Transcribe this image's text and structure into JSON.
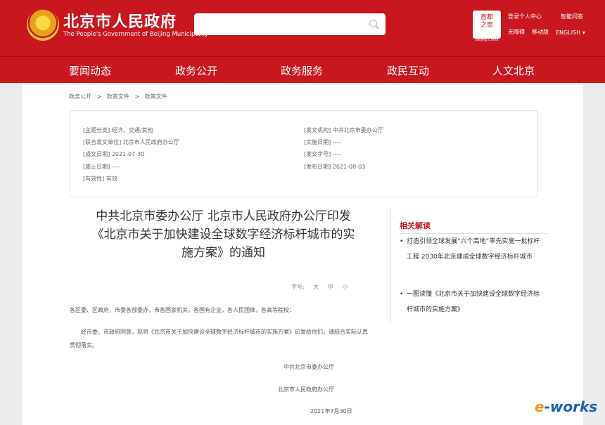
{
  "header": {
    "title": "北京市人民政府",
    "subtitle": "The People's Government of Beijing Municipality",
    "search_placeholder": "",
    "seal_top": "首都",
    "seal_bottom": "之窗",
    "seal_sub": "Beijing China",
    "links": [
      "登录个人中心",
      "智能问答",
      "无障碍",
      "移动版",
      "ENGLISH"
    ]
  },
  "nav": [
    "要闻动态",
    "政务公开",
    "政务服务",
    "政民互动",
    "人文北京"
  ],
  "breadcrumb": [
    "政务公开",
    ">",
    "政策文件",
    ">",
    "政策文件"
  ],
  "info": {
    "left": [
      "[主题分类] 经济、交通/其他",
      "[联合发文单位] 北京市人民政府办公厅",
      "[成文日期] 2021-07-30",
      "[废止日期] ----",
      "[有效性] 有效"
    ],
    "right": [
      "[发文机构] 中共北京市委办公厅",
      "[实施日期] ----",
      "[发文字号] ----",
      "[发布日期] 2021-08-03"
    ]
  },
  "article": {
    "title_lines": [
      "中共北京市委办公厅 北京市人民政府办公厅印发",
      "《北京市关于加快建设全球数字经济标杆城市的实",
      "施方案》的通知"
    ],
    "font_size_label": "字号:",
    "font_sizes": [
      "大",
      "中",
      "小"
    ],
    "salutation": "各区委、区政府，市委各部委办，市各国家机关，各国有企业，各人民团体，各高等院校：",
    "body": "经市委、市政府同意，现将《北京市关于加快建设全球数字经济标杆城市的实施方案》印发给你们，请结合实际认真贯彻落实。",
    "signatures": [
      "中共北京市委办公厅",
      "北京市人民政府办公厅",
      "2021年7月30日"
    ]
  },
  "related": {
    "heading": "相关解读",
    "items": [
      "打造引领全球发展“六个高地”率先实施一批标杆工程 2030年北京建成全球数字经济标杆城市",
      "一图读懂《北京市关于加快建设全球数字经济标杆城市的实施方案》"
    ]
  },
  "watermark": {
    "prefix": "e",
    "suffix": "-works"
  },
  "colors": {
    "brand_red": "#c8171e",
    "page_bg": "#ececec"
  }
}
